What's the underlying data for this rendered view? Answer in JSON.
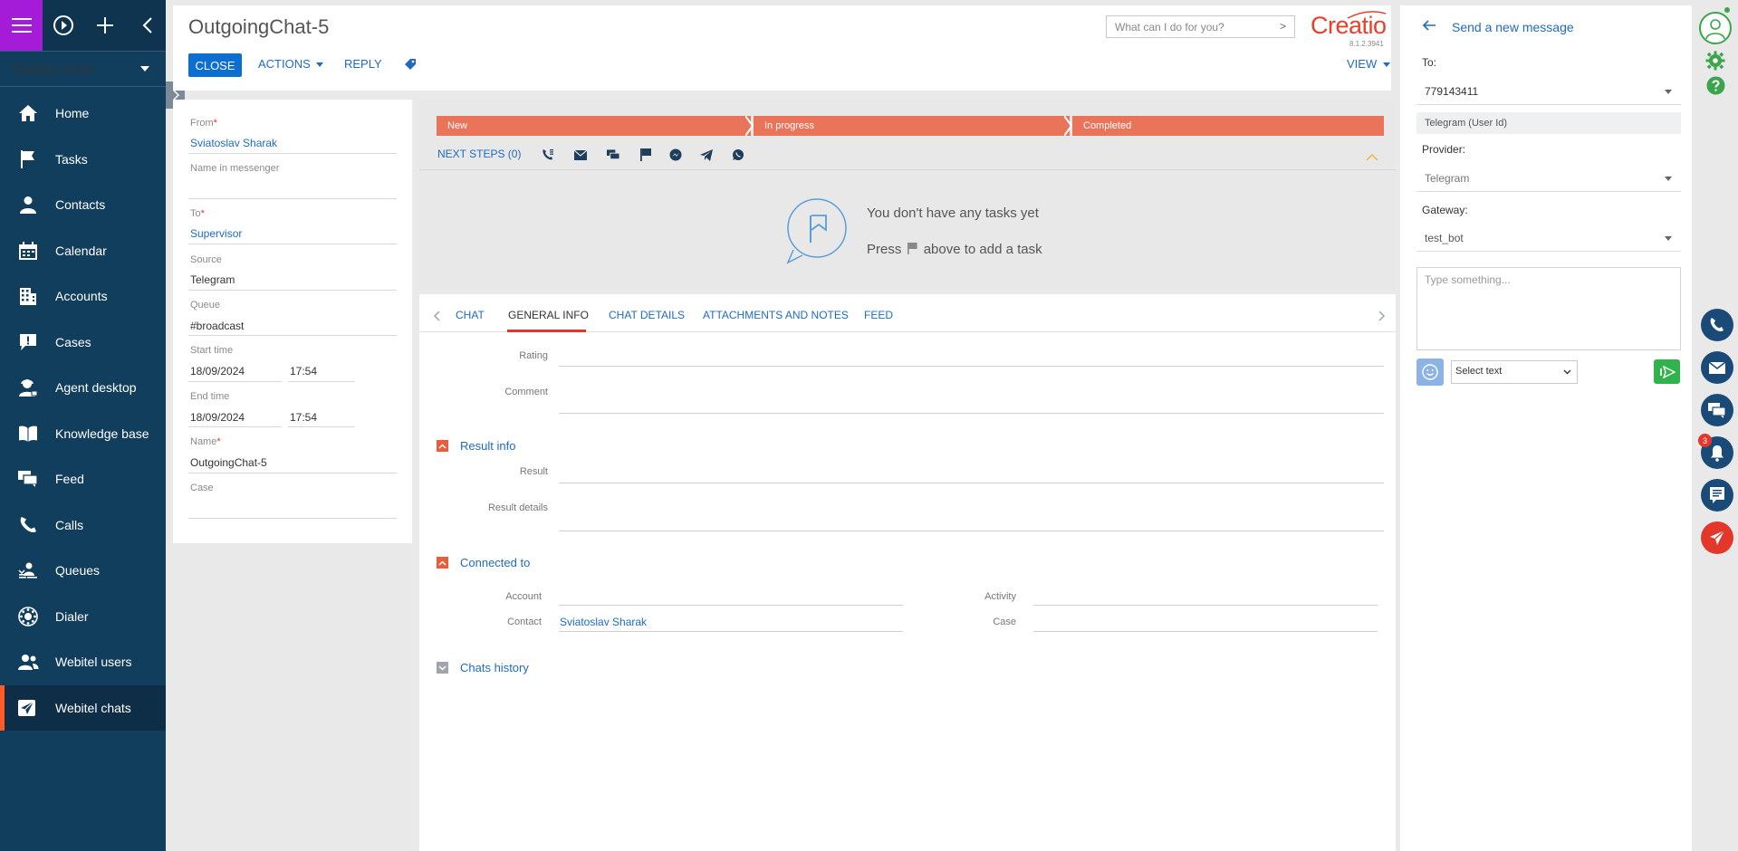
{
  "app": {
    "workplace": "Contact center",
    "logo": "Creatio",
    "version": "8.1.2.3941"
  },
  "nav": {
    "items": [
      {
        "label": "Home",
        "icon": "home-icon"
      },
      {
        "label": "Tasks",
        "icon": "flag-icon"
      },
      {
        "label": "Contacts",
        "icon": "person-icon"
      },
      {
        "label": "Calendar",
        "icon": "calendar-icon"
      },
      {
        "label": "Accounts",
        "icon": "building-icon"
      },
      {
        "label": "Cases",
        "icon": "exclamation-bubble-icon"
      },
      {
        "label": "Agent desktop",
        "icon": "agent-icon"
      },
      {
        "label": "Knowledge base",
        "icon": "book-icon"
      },
      {
        "label": "Feed",
        "icon": "chat-bubbles-icon"
      },
      {
        "label": "Calls",
        "icon": "phone-icon"
      },
      {
        "label": "Queues",
        "icon": "queue-icon"
      },
      {
        "label": "Dialer",
        "icon": "dialer-icon"
      },
      {
        "label": "Webitel users",
        "icon": "users-icon"
      },
      {
        "label": "Webitel chats",
        "icon": "send-icon"
      }
    ],
    "active_index": 13
  },
  "header": {
    "title": "OutgoingChat-5",
    "close": "CLOSE",
    "actions": "ACTIONS",
    "reply": "REPLY",
    "view": "VIEW",
    "search_placeholder": "What can I do for you?"
  },
  "form": {
    "from_label": "From",
    "from_value": "Sviatoslav Sharak",
    "name_in_messenger_label": "Name in messenger",
    "name_in_messenger_value": "",
    "to_label": "To",
    "to_value": "Supervisor",
    "source_label": "Source",
    "source_value": "Telegram",
    "queue_label": "Queue",
    "queue_value": "#broadcast",
    "start_time_label": "Start time",
    "start_date": "18/09/2024",
    "start_time": "17:54",
    "end_time_label": "End time",
    "end_date": "18/09/2024",
    "end_time": "17:54",
    "name_label": "Name",
    "name_value": "OutgoingChat-5",
    "case_label": "Case",
    "case_value": ""
  },
  "stages": [
    "New",
    "In progress",
    "Completed"
  ],
  "next_steps": {
    "label": "NEXT STEPS (0)",
    "icons": [
      "phone-list-icon",
      "envelope-icon",
      "chat-icon",
      "flag-icon",
      "messenger-icon",
      "telegram-icon",
      "whatsapp-icon"
    ],
    "empty_title": "You don't have any tasks yet",
    "empty_hint_pre": "Press",
    "empty_hint_post": "above to add a task"
  },
  "tabs": {
    "items": [
      "CHAT",
      "GENERAL INFO",
      "CHAT DETAILS",
      "ATTACHMENTS AND NOTES",
      "FEED"
    ],
    "active_index": 1
  },
  "general_info": {
    "rating_label": "Rating",
    "comment_label": "Comment",
    "result_info_title": "Result info",
    "result_label": "Result",
    "result_details_label": "Result details",
    "connected_to_title": "Connected to",
    "account_label": "Account",
    "contact_label": "Contact",
    "contact_value": "Sviatoslav Sharak",
    "activity_label": "Activity",
    "case_label": "Case",
    "chats_history_title": "Chats history"
  },
  "send_message": {
    "title": "Send a new message",
    "to_label": "To:",
    "to_value": "779143411",
    "to_type": "Telegram (User Id)",
    "provider_label": "Provider:",
    "provider_value": "Telegram",
    "gateway_label": "Gateway:",
    "gateway_value": "test_bot",
    "message_placeholder": "Type something...",
    "select_text": "Select text"
  },
  "right_toolbar": {
    "notification_count": "3"
  },
  "colors": {
    "nav_bg": "#123e5e",
    "hamburger_bg": "#a41bd8",
    "accent_blue": "#0d6ed2",
    "stage_orange": "#ea7459",
    "brand_red": "#e9402a",
    "active_marker": "#ff5a28"
  }
}
